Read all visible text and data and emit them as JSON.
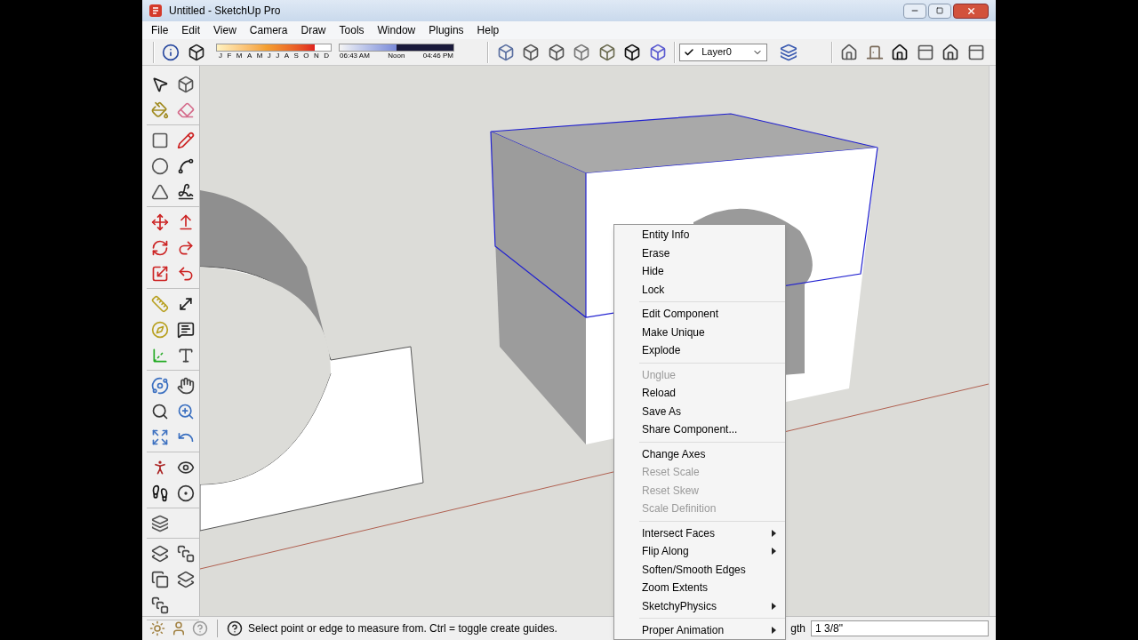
{
  "window": {
    "title": "Untitled - SketchUp Pro"
  },
  "menu": [
    "File",
    "Edit",
    "View",
    "Camera",
    "Draw",
    "Tools",
    "Window",
    "Plugins",
    "Help"
  ],
  "month_slider": {
    "labels": [
      "J",
      "F",
      "M",
      "A",
      "M",
      "J",
      "J",
      "A",
      "S",
      "O",
      "N",
      "D"
    ],
    "level": 0.86
  },
  "time_slider": {
    "labels": [
      "06:43 AM",
      "Noon",
      "04:46 PM"
    ],
    "level": 0.5
  },
  "layer_select": {
    "checked": true,
    "value": "Layer0"
  },
  "context_menu": {
    "groups": [
      [
        {
          "label": "Entity Info",
          "disabled": false,
          "submenu": false
        },
        {
          "label": "Erase",
          "disabled": false,
          "submenu": false
        },
        {
          "label": "Hide",
          "disabled": false,
          "submenu": false
        },
        {
          "label": "Lock",
          "disabled": false,
          "submenu": false
        }
      ],
      [
        {
          "label": "Edit Component",
          "disabled": false,
          "submenu": false
        },
        {
          "label": "Make Unique",
          "disabled": false,
          "submenu": false
        },
        {
          "label": "Explode",
          "disabled": false,
          "submenu": false
        }
      ],
      [
        {
          "label": "Unglue",
          "disabled": true,
          "submenu": false
        },
        {
          "label": "Reload",
          "disabled": false,
          "submenu": false
        },
        {
          "label": "Save As",
          "disabled": false,
          "submenu": false
        },
        {
          "label": "Share Component...",
          "disabled": false,
          "submenu": false
        }
      ],
      [
        {
          "label": "Change Axes",
          "disabled": false,
          "submenu": false
        },
        {
          "label": "Reset Scale",
          "disabled": true,
          "submenu": false
        },
        {
          "label": "Reset Skew",
          "disabled": true,
          "submenu": false
        },
        {
          "label": "Scale Definition",
          "disabled": true,
          "submenu": false
        }
      ],
      [
        {
          "label": "Intersect Faces",
          "disabled": false,
          "submenu": true
        },
        {
          "label": "Flip Along",
          "disabled": false,
          "submenu": true
        },
        {
          "label": "Soften/Smooth Edges",
          "disabled": false,
          "submenu": false
        },
        {
          "label": "Zoom Extents",
          "disabled": false,
          "submenu": false
        },
        {
          "label": "SketchyPhysics",
          "disabled": false,
          "submenu": true
        }
      ],
      [
        {
          "label": "Proper Animation",
          "disabled": false,
          "submenu": true
        }
      ]
    ]
  },
  "status_bar": {
    "message": "Select point or edge to measure from. Ctrl = toggle create guides.",
    "measurement_label": "gth",
    "measurement_value": "1 3/8\""
  }
}
